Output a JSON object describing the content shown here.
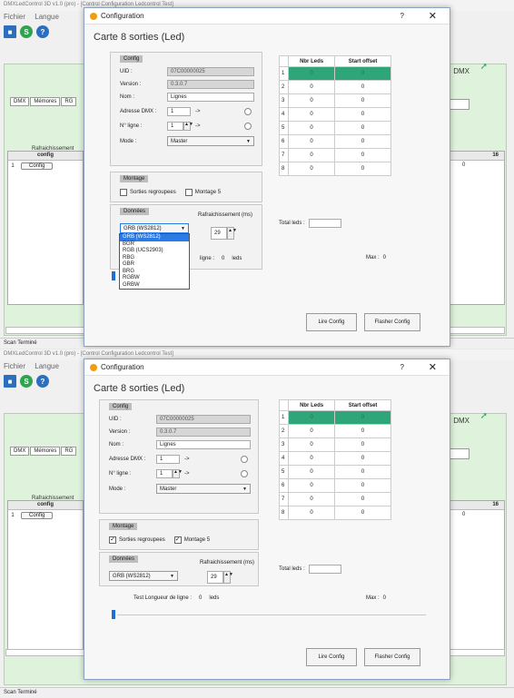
{
  "app": {
    "window_title": "DMXLedControl 3D v1.0 (pro) - [Control Configuration Ledcontrol Test]",
    "menu": [
      "Fichier",
      "Langue"
    ],
    "tabs": [
      "DMX",
      "Mémores",
      "RG"
    ],
    "dmx_label": "DMX",
    "refresh_label": "Rafraichissement",
    "grid_header": "config",
    "grid_row_num": "1",
    "grid_row_button": "Config",
    "right_grid_headers": [
      "15",
      "16"
    ],
    "right_grid_value": "0",
    "spin_value": "1",
    "status": "Scan Terminé"
  },
  "dialog": {
    "title": "Configuration",
    "help": "?",
    "close": "✕",
    "heading": "Carte 8 sorties (Led)",
    "config_group": "Config",
    "uid_label": "UID :",
    "uid_value": "07C00000025",
    "version_label": "Version :",
    "version_value": "0.3.0.7",
    "name_label": "Nom :",
    "name_value": "Lignes",
    "dmx_address_label": "Adresse DMX :",
    "dmx_address_value": "1",
    "line_no_label": "N° ligne :",
    "line_no_value": "1",
    "arrow": "->",
    "mode_label": "Mode :",
    "mode_value": "Master",
    "montage_group": "Montage",
    "sorties_label": "Sorties regroupees",
    "montage5_label": "Montage 5",
    "donnees_group": "Données",
    "refresh_label": "Rafraichissement (ms)",
    "refresh_value": "29",
    "color_order_value": "GRB (WS2812)",
    "color_options": [
      "GRB (WS2812)",
      "BGR",
      "RGB (UCS2903)",
      "RBG",
      "GBR",
      "BRG",
      "RGBW",
      "GRBW"
    ],
    "test_label": "Test Longueur de ligne :",
    "test_value": "0",
    "test_unit": "leds",
    "test_short_label": "ligne :",
    "test_short_unit": "leds",
    "max_label": "Max :",
    "max_value": "0",
    "total_leds_label": "Total leds :",
    "total_leds_value": "",
    "table_headers": [
      "Nbr Leds",
      "Start offset"
    ],
    "table_rows": [
      {
        "n": "1",
        "leds": "0",
        "offset": "0"
      },
      {
        "n": "2",
        "leds": "0",
        "offset": "0"
      },
      {
        "n": "3",
        "leds": "0",
        "offset": "0"
      },
      {
        "n": "4",
        "leds": "0",
        "offset": "0"
      },
      {
        "n": "5",
        "leds": "0",
        "offset": "0"
      },
      {
        "n": "6",
        "leds": "0",
        "offset": "0"
      },
      {
        "n": "7",
        "leds": "0",
        "offset": "0"
      },
      {
        "n": "8",
        "leds": "0",
        "offset": "0"
      }
    ],
    "read_button": "Lire Config",
    "flash_button": "Flasher Config"
  },
  "states": {
    "top": {
      "sorties_checked": "",
      "montage5_checked": ""
    },
    "bottom": {
      "sorties_checked": "✓",
      "montage5_checked": "✓"
    }
  }
}
